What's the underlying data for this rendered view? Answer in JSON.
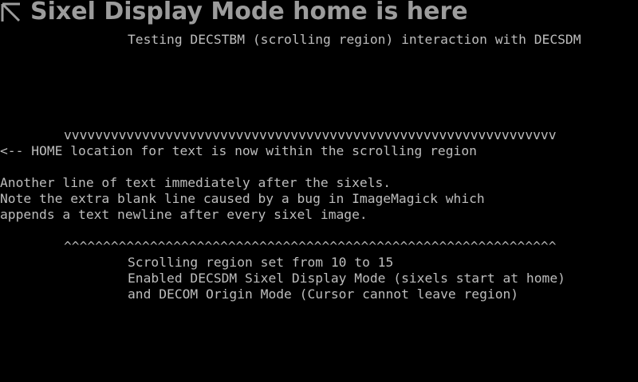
{
  "banner": {
    "icon": "arrow-up-left-icon",
    "title": "Sixel Display Mode home is here"
  },
  "terminal": {
    "fg_color": "#bdbdbd",
    "bg_color": "#000000",
    "header": "Testing DECSTBM (scrolling region) interaction with DECSDM",
    "down_markers": "vvvvvvvvvvvvvvvvvvvvvvvvvvvvvvvvvvvvvvvvvvvvvvvvvvvvvvvvvvvvvvv",
    "home_note": "<-- HOME location for text is now within the scrolling region",
    "after_sixels": "Another line of text immediately after the sixels.",
    "bug_note_1": "Note the extra blank line caused by a bug in ImageMagick which",
    "bug_note_2": "appends a text newline after every sixel image.",
    "up_markers": "^^^^^^^^^^^^^^^^^^^^^^^^^^^^^^^^^^^^^^^^^^^^^^^^^^^^^^^^^^^^^^^",
    "region_info": "Scrolling region set from 10 to 15",
    "decsdm_info": "Enabled DECSDM Sixel Display Mode (sixels start at home)",
    "decom_info": "and DECOM Origin Mode (Cursor cannot leave region)"
  }
}
